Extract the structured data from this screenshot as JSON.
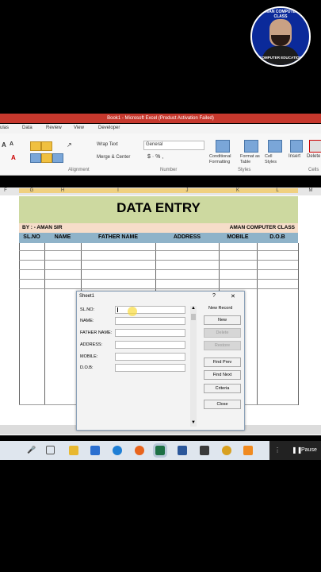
{
  "logo": {
    "top_text": "AMAN COMPUTER CLASS",
    "bottom_text": "COMPUTER EDUCATION"
  },
  "excel": {
    "window_title": "Book1 - Microsoft Excel (Product Activation Failed)",
    "tabs": [
      "ulas",
      "Data",
      "Review",
      "View",
      "Developer"
    ],
    "ribbon": {
      "wrap_text": "Wrap Text",
      "merge_center": "Merge & Center",
      "number_format": "General",
      "conditional_formatting": "Conditional Formatting",
      "format_as_table": "Format as Table",
      "cell_styles": "Cell Styles",
      "insert": "Insert",
      "delete": "Delete",
      "group_alignment": "Alignment",
      "group_number": "Number",
      "group_styles": "Styles",
      "group_cells": "Cells"
    },
    "columns": [
      "F",
      "G",
      "H",
      "I",
      "J",
      "K",
      "L",
      "M"
    ],
    "sheet": {
      "title": "DATA ENTRY",
      "by": "BY : - AMAN SIR",
      "brand": "AMAN COMPUTER CLASS",
      "headers": [
        "SL.NO",
        "NAME",
        "FATHER NAME",
        "ADDRESS",
        "MOBILE",
        "D.O.B"
      ]
    }
  },
  "dialog": {
    "title": "Sheet1",
    "help": "?",
    "close": "✕",
    "record_status": "New Record",
    "fields": [
      {
        "label": "SL.NO:",
        "value": ""
      },
      {
        "label": "NAME:",
        "value": ""
      },
      {
        "label": "FATHER NAME:",
        "value": ""
      },
      {
        "label": "ADDRESS:",
        "value": ""
      },
      {
        "label": "MOBILE:",
        "value": ""
      },
      {
        "label": "D.O.B:",
        "value": ""
      }
    ],
    "buttons": {
      "new": "New",
      "delete": "Delete",
      "restore": "Restore",
      "find_prev": "Find Prev",
      "find_next": "Find Next",
      "criteria": "Criteria",
      "close": "Close"
    }
  },
  "taskbar": {
    "pause": "Pause"
  }
}
